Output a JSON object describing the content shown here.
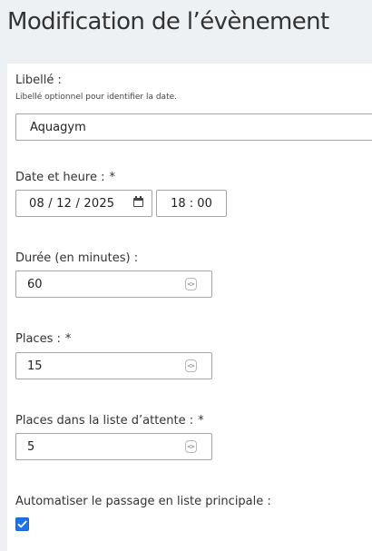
{
  "page": {
    "title": "Modification de l’évènement"
  },
  "form": {
    "libelle": {
      "label": "Libellé :",
      "help": "Libellé optionnel pour identifier la date.",
      "value": "Aquagym"
    },
    "date_heure": {
      "label": "Date et heure :",
      "required_mark": "*",
      "date_value": "08 / 12 / 2025",
      "time_value": "18 : 00"
    },
    "duree": {
      "label": "Durée (en minutes) :",
      "value": "60"
    },
    "places": {
      "label": "Places :",
      "required_mark": "*",
      "value": "15"
    },
    "places_attente": {
      "label": "Places dans la liste d’attente :",
      "required_mark": "*",
      "value": "5"
    },
    "automatiser": {
      "label": "Automatiser le passage en liste principale :",
      "checked": true
    }
  },
  "icons": {
    "calendar": "calendar-icon",
    "spinner": "spinner-icon",
    "checkmark": "checkmark-icon"
  },
  "colors": {
    "checkbox_accent": "#1a73e8",
    "page_background": "#eef1f4",
    "panel_background": "#ffffff"
  }
}
